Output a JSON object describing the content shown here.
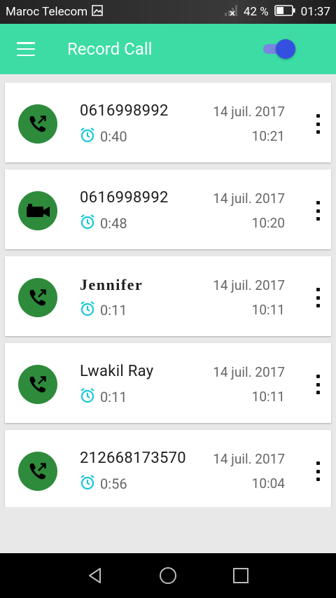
{
  "status_bar": {
    "carrier": "Maroc Telecom",
    "battery": "42 %",
    "time": "01:37"
  },
  "app_bar": {
    "title": "Record Call",
    "toggle_on": true
  },
  "recordings": [
    {
      "contact": "0616998992",
      "type": "call",
      "duration": "0:40",
      "date": "14 juil. 2017",
      "time": "10:21"
    },
    {
      "contact": "0616998992",
      "type": "video",
      "duration": "0:48",
      "date": "14 juil. 2017",
      "time": "10:20"
    },
    {
      "contact": "Jennifer",
      "type": "call",
      "duration": "0:11",
      "date": "14 juil. 2017",
      "time": "10:11"
    },
    {
      "contact": "Lwakil Ray",
      "type": "call",
      "duration": "0:11",
      "date": "14 juil. 2017",
      "time": "10:11"
    },
    {
      "contact": "212668173570",
      "type": "call",
      "duration": "0:56",
      "date": "14 juil. 2017",
      "time": "10:04"
    }
  ],
  "icons": {
    "call": "outgoing-call-icon",
    "video": "video-camera-icon",
    "duration": "alarm-clock-icon",
    "more": "more-vert-icon"
  },
  "colors": {
    "app_bar": "#3ddca5",
    "avatar": "#2e8b3c",
    "duration_icon": "#18c7d8",
    "toggle": "#3350e0"
  }
}
